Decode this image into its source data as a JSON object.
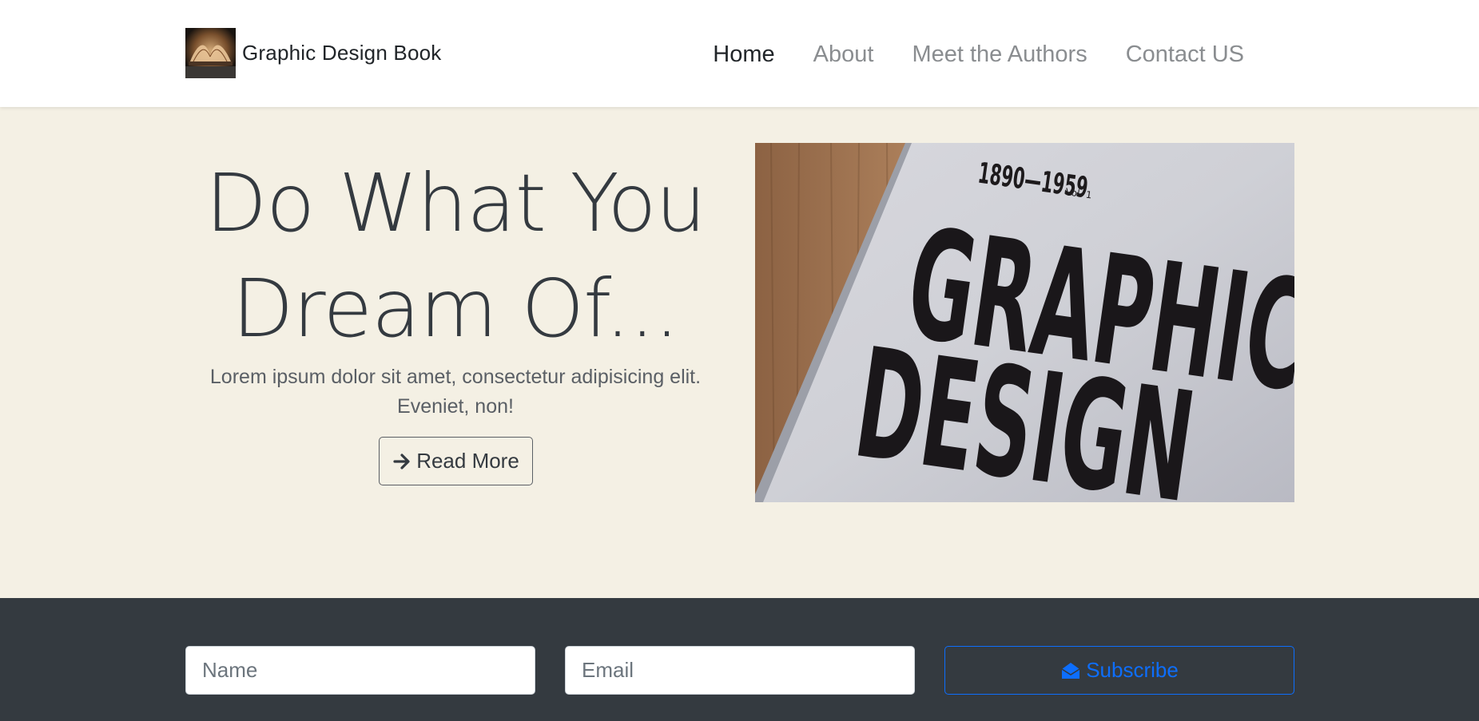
{
  "navbar": {
    "brand_name": "Graphic Design Book",
    "brand_logo_icon": "open-book-logo",
    "links": [
      {
        "label": "Home",
        "active": true
      },
      {
        "label": "About",
        "active": false
      },
      {
        "label": "Meet the Authors",
        "active": false
      },
      {
        "label": "Contact US",
        "active": false
      }
    ]
  },
  "hero": {
    "title_line1": "Do What You",
    "title_line2": "Dream Of...",
    "subtitle": "Lorem ipsum dolor sit amet, consectetur adipisicing elit. Eveniet, non!",
    "button_label": "Read More",
    "button_icon": "arrow-right-icon",
    "image": {
      "cover_vol": "Vol. 1",
      "cover_years": "1890—1959",
      "cover_title_line1": "GRAPHIC",
      "cover_title_line2": "DESIGN"
    }
  },
  "subscribe": {
    "name_placeholder": "Name",
    "email_placeholder": "Email",
    "button_label": "Subscribe",
    "button_icon": "envelope-open-icon"
  },
  "colors": {
    "hero_bg": "#f4f0e4",
    "footer_bg": "#343a40",
    "primary": "#0d6efd",
    "text_dark": "#343a40"
  }
}
